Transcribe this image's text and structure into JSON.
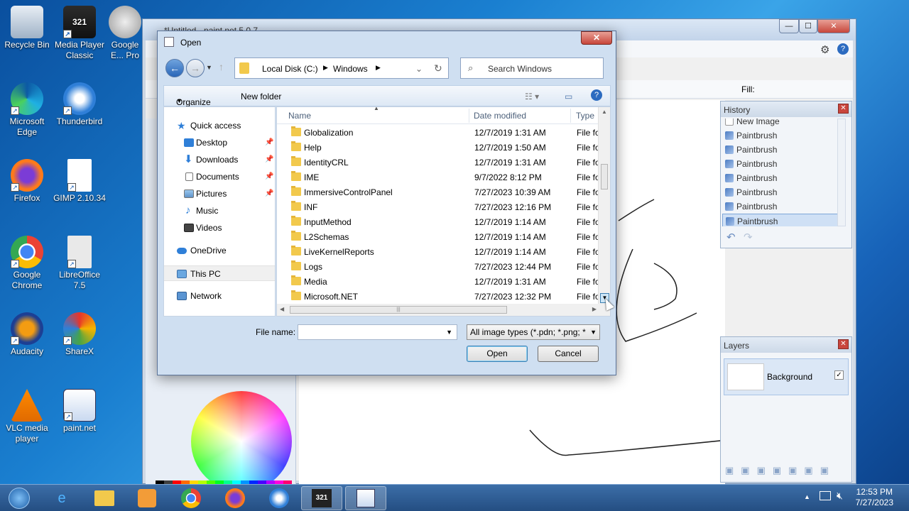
{
  "desktop": {
    "icons": [
      {
        "label": "Recycle Bin"
      },
      {
        "label": "Media Player Classic"
      },
      {
        "label": "Google E... Pro"
      },
      {
        "label": "Microsoft Edge"
      },
      {
        "label": "Thunderbird"
      },
      {
        "label": "Firefox"
      },
      {
        "label": "GIMP 2.10.34"
      },
      {
        "label": "Google Chrome"
      },
      {
        "label": "LibreOffice 7.5"
      },
      {
        "label": "Audacity"
      },
      {
        "label": "ShareX"
      },
      {
        "label": "VLC media player"
      },
      {
        "label": "paint.net"
      }
    ]
  },
  "paintnet": {
    "title": "*Untitled - paint.net 5.0.7",
    "fill_label": "Fill:",
    "history": {
      "title": "History",
      "items": [
        "New Image",
        "Paintbrush",
        "Paintbrush",
        "Paintbrush",
        "Paintbrush",
        "Paintbrush",
        "Paintbrush",
        "Paintbrush"
      ]
    },
    "layers": {
      "title": "Layers",
      "items": [
        {
          "name": "Background"
        }
      ]
    }
  },
  "dialog": {
    "title": "Open",
    "close_label": "✕",
    "breadcrumb": {
      "drive": "Local Disk (C:)",
      "folder": "Windows"
    },
    "search_placeholder": "Search Windows",
    "toolbar": {
      "organize": "Organize",
      "new_folder": "New folder"
    },
    "nav": {
      "quick_access": "Quick access",
      "items": [
        "Desktop",
        "Downloads",
        "Documents",
        "Pictures",
        "Music",
        "Videos"
      ],
      "onedrive": "OneDrive",
      "this_pc": "This PC",
      "network": "Network"
    },
    "columns": {
      "name": "Name",
      "date": "Date modified",
      "type": "Type"
    },
    "rows": [
      {
        "name": "Globalization",
        "date": "12/7/2019 1:31 AM",
        "type": "File fo"
      },
      {
        "name": "Help",
        "date": "12/7/2019 1:50 AM",
        "type": "File fo"
      },
      {
        "name": "IdentityCRL",
        "date": "12/7/2019 1:31 AM",
        "type": "File fo"
      },
      {
        "name": "IME",
        "date": "9/7/2022 8:12 PM",
        "type": "File fo"
      },
      {
        "name": "ImmersiveControlPanel",
        "date": "7/27/2023 10:39 AM",
        "type": "File fo"
      },
      {
        "name": "INF",
        "date": "7/27/2023 12:16 PM",
        "type": "File fo"
      },
      {
        "name": "InputMethod",
        "date": "12/7/2019 1:14 AM",
        "type": "File fo"
      },
      {
        "name": "L2Schemas",
        "date": "12/7/2019 1:14 AM",
        "type": "File fo"
      },
      {
        "name": "LiveKernelReports",
        "date": "12/7/2019 1:14 AM",
        "type": "File fo"
      },
      {
        "name": "Logs",
        "date": "7/27/2023 12:44 PM",
        "type": "File fo"
      },
      {
        "name": "Media",
        "date": "12/7/2019 1:31 AM",
        "type": "File fo"
      },
      {
        "name": "Microsoft.NET",
        "date": "7/27/2023 12:32 PM",
        "type": "File fo"
      }
    ],
    "file_name_label": "File name:",
    "file_name_value": "",
    "file_type": "All image types (*.pdn; *.png; *",
    "open_button": "Open",
    "cancel_button": "Cancel"
  },
  "taskbar": {
    "time": "12:53 PM",
    "date": "7/27/2023"
  }
}
